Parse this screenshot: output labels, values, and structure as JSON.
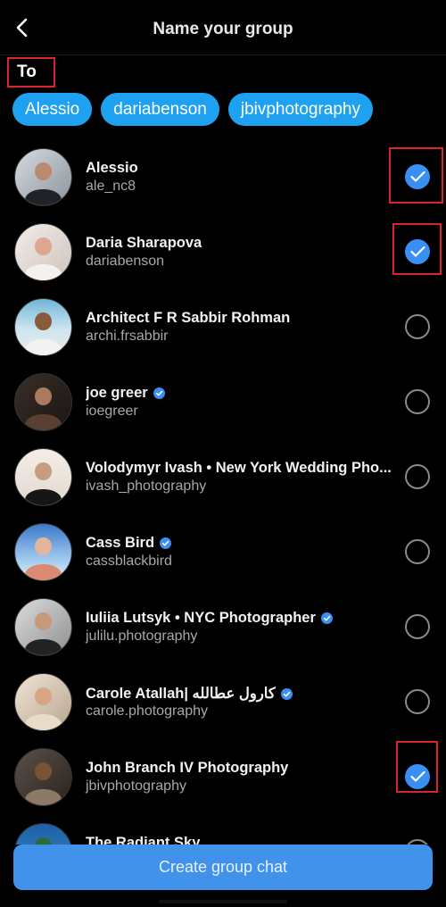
{
  "header": {
    "title": "Name your group",
    "back_icon": "chevron-left-icon"
  },
  "to_label": "To",
  "chips": [
    "Alessio",
    "dariabenson",
    "jbivphotography"
  ],
  "contacts": [
    {
      "name": "Alessio",
      "handle": "ale_nc8",
      "verified": false,
      "selected": true
    },
    {
      "name": "Daria Sharapova",
      "handle": "dariabenson",
      "verified": false,
      "selected": true
    },
    {
      "name": "Architect F R Sabbir Rohman",
      "handle": "archi.frsabbir",
      "verified": false,
      "selected": false
    },
    {
      "name": "joe greer",
      "handle": "ioegreer",
      "verified": true,
      "selected": false
    },
    {
      "name": "Volodymyr Ivash • New York Wedding Pho...",
      "handle": "ivash_photography",
      "verified": false,
      "selected": false
    },
    {
      "name": "Cass Bird",
      "handle": "cassblackbird",
      "verified": true,
      "selected": false
    },
    {
      "name": "Iuliia Lutsyk • NYC Photographer",
      "handle": "julilu.photography",
      "verified": true,
      "selected": false
    },
    {
      "name": "Carole Atallah| كارول عطالله",
      "handle": "carole.photography",
      "verified": true,
      "selected": false
    },
    {
      "name": "John Branch IV Photography",
      "handle": "jbivphotography",
      "verified": false,
      "selected": true
    },
    {
      "name": "The Radiant Sky",
      "handle": "",
      "verified": false,
      "selected": false
    }
  ],
  "create_button": "Create group chat",
  "colors": {
    "accent": "#3a8ff5",
    "chip": "#1fa1f1",
    "highlight": "#d8262c",
    "background": "#000000"
  }
}
